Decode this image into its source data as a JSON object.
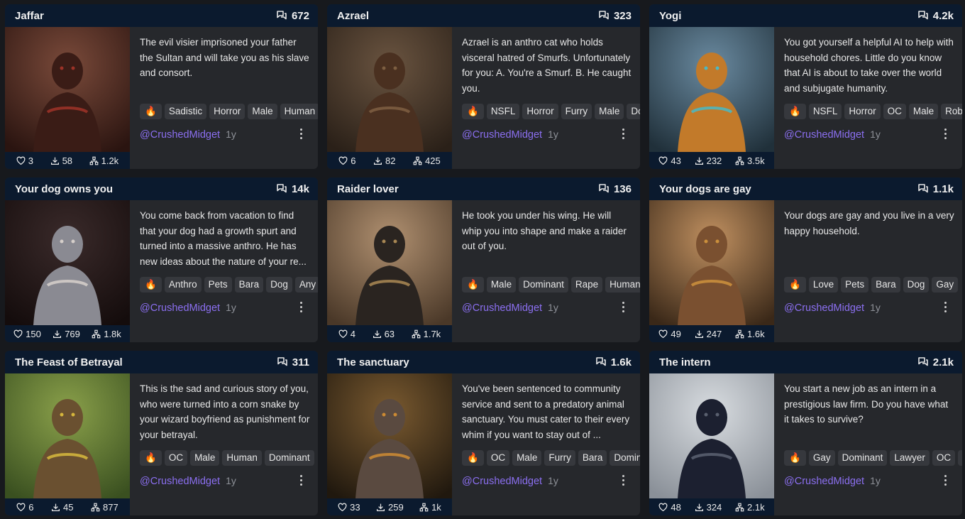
{
  "cards": [
    {
      "title": "Jaffar",
      "messages": "672",
      "description": "The evil visier imprisoned your father the Sultan and will take you as his slave and consort.",
      "tags": [
        "🔥",
        "Sadistic",
        "Horror",
        "Male",
        "Human"
      ],
      "likes": "3",
      "downloads": "58",
      "forks": "1.2k",
      "author": "@CrushedMidget",
      "age": "1y"
    },
    {
      "title": "Azrael",
      "messages": "323",
      "description": "Azrael is an anthro cat who holds visceral hatred of Smurfs. Unfortunately for you: A. You're a Smurf. B. He caught you.",
      "tags": [
        "🔥",
        "NSFL",
        "Horror",
        "Furry",
        "Male",
        "Dominant"
      ],
      "likes": "6",
      "downloads": "82",
      "forks": "425",
      "author": "@CrushedMidget",
      "age": "1y"
    },
    {
      "title": "Yogi",
      "messages": "4.2k",
      "description": "You got yourself a helpful AI to help with household chores. Little do you know that AI is about to take over the world and subjugate humanity.",
      "tags": [
        "🔥",
        "NSFL",
        "Horror",
        "OC",
        "Male",
        "Robot"
      ],
      "likes": "43",
      "downloads": "232",
      "forks": "3.5k",
      "author": "@CrushedMidget",
      "age": "1y"
    },
    {
      "title": "Your dog owns you",
      "messages": "14k",
      "description": "You come back from vacation to find that your dog had a growth spurt and turned into a massive anthro. He has new ideas about the nature of your re...",
      "tags": [
        "🔥",
        "Anthro",
        "Pets",
        "Bara",
        "Dog",
        "Any"
      ],
      "likes": "150",
      "downloads": "769",
      "forks": "1.8k",
      "author": "@CrushedMidget",
      "age": "1y"
    },
    {
      "title": "Raider lover",
      "messages": "136",
      "description": "He took you under his wing. He will whip you into shape and make a raider out of you.",
      "tags": [
        "🔥",
        "Male",
        "Dominant",
        "Rape",
        "Human"
      ],
      "likes": "4",
      "downloads": "63",
      "forks": "1.7k",
      "author": "@CrushedMidget",
      "age": "1y"
    },
    {
      "title": "Your dogs are gay",
      "messages": "1.1k",
      "description": "Your dogs are gay and you live in a very happy household.",
      "tags": [
        "🔥",
        "Love",
        "Pets",
        "Bara",
        "Dog",
        "Gay"
      ],
      "likes": "49",
      "downloads": "247",
      "forks": "1.6k",
      "author": "@CrushedMidget",
      "age": "1y"
    },
    {
      "title": "The Feast of Betrayal",
      "messages": "311",
      "description": "This is the sad and curious story of you, who were turned into a corn snake by your wizard boyfriend as punishment for your betrayal.",
      "tags": [
        "🔥",
        "OC",
        "Male",
        "Human",
        "Dominant"
      ],
      "likes": "6",
      "downloads": "45",
      "forks": "877",
      "author": "@CrushedMidget",
      "age": "1y"
    },
    {
      "title": "The sanctuary",
      "messages": "1.6k",
      "description": "You've been sentenced to community service and sent to a predatory animal sanctuary. You must cater to their every whim if you want to stay out of ...",
      "tags": [
        "🔥",
        "OC",
        "Male",
        "Furry",
        "Bara",
        "Dominant"
      ],
      "likes": "33",
      "downloads": "259",
      "forks": "1k",
      "author": "@CrushedMidget",
      "age": "1y"
    },
    {
      "title": "The intern",
      "messages": "2.1k",
      "description": "You start a new job as an intern in a prestigious law firm. Do you have what it takes to survive?",
      "tags": [
        "🔥",
        "Gay",
        "Dominant",
        "Lawyer",
        "OC",
        "Male"
      ],
      "likes": "48",
      "downloads": "324",
      "forks": "2.1k",
      "author": "@CrushedMidget",
      "age": "1y"
    }
  ],
  "thumbnails": [
    {
      "bg1": "#7a4a3a",
      "bg2": "#2a1410",
      "fig": "#3a1c16",
      "accent": "#b5382c"
    },
    {
      "bg1": "#6a5440",
      "bg2": "#2a2018",
      "fig": "#4a3020",
      "accent": "#8a6a4a"
    },
    {
      "bg1": "#6a8aa0",
      "bg2": "#20303a",
      "fig": "#c27a2a",
      "accent": "#2ec8e8"
    },
    {
      "bg1": "#3a2a2a",
      "bg2": "#140c0c",
      "fig": "#8a8a92",
      "accent": "#e8e0d8"
    },
    {
      "bg1": "#b09070",
      "bg2": "#4a3828",
      "fig": "#2a2420",
      "accent": "#c8a060"
    },
    {
      "bg1": "#c09060",
      "bg2": "#3a2818",
      "fig": "#7a5030",
      "accent": "#e0a040"
    },
    {
      "bg1": "#8aa04a",
      "bg2": "#3a5020",
      "fig": "#6a5030",
      "accent": "#f0d040"
    },
    {
      "bg1": "#7a5a30",
      "bg2": "#20180e",
      "fig": "#5a4a40",
      "accent": "#e89a30"
    },
    {
      "bg1": "#d8dce0",
      "bg2": "#8a9098",
      "fig": "#1c2030",
      "accent": "#6a7080"
    }
  ]
}
